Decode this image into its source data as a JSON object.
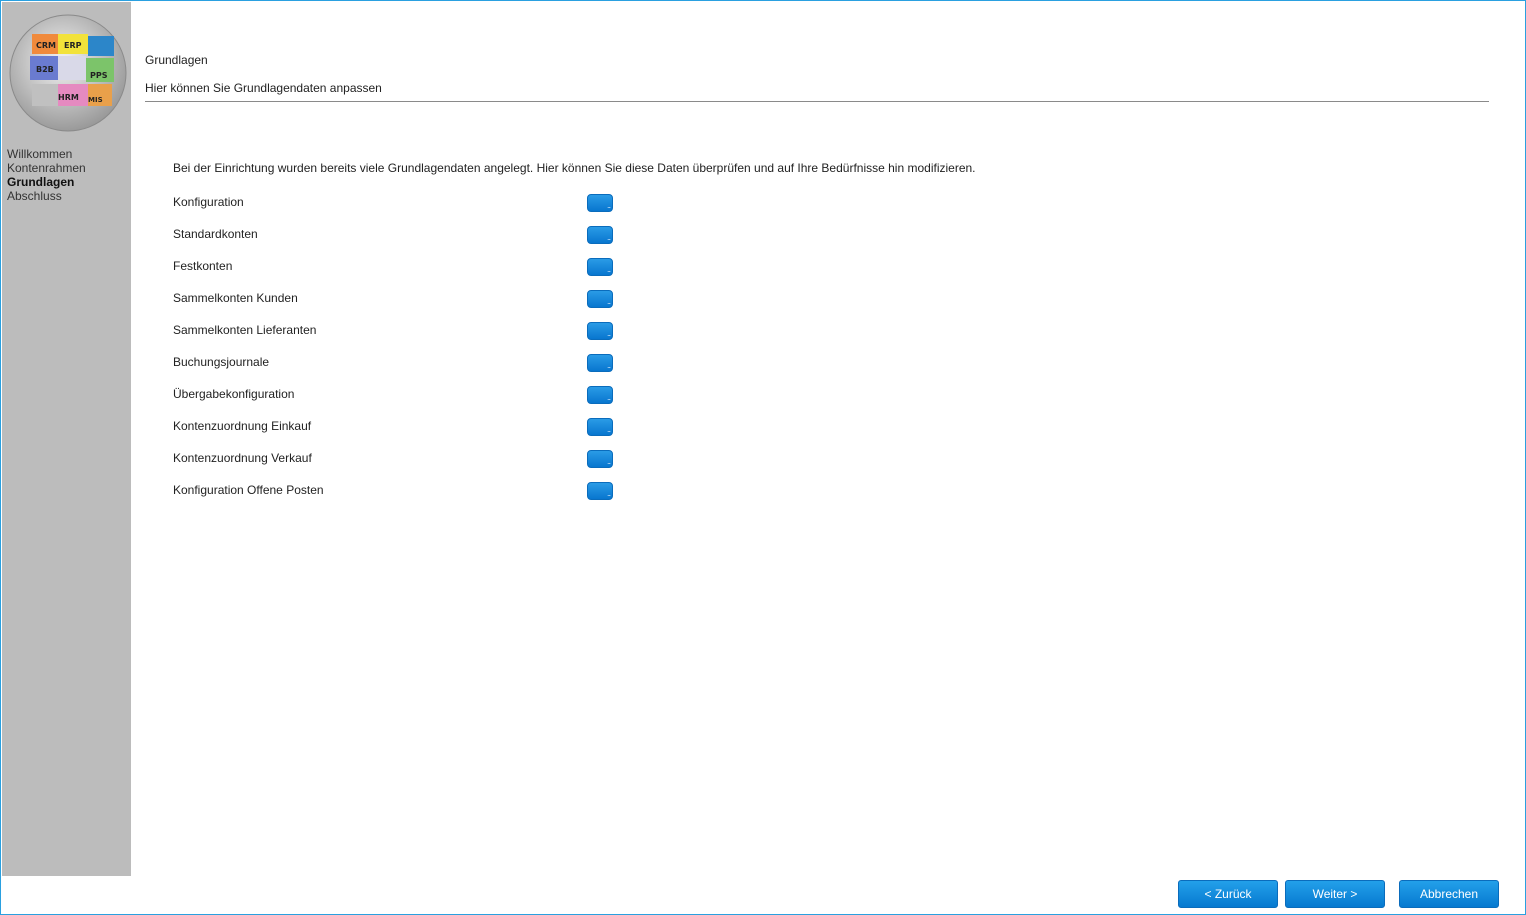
{
  "logo": {
    "pieces": [
      "CRM",
      "ERP",
      "B2B",
      "PPS",
      "HRM",
      "MIS"
    ]
  },
  "sidebar": {
    "items": [
      {
        "label": "Willkommen",
        "active": false
      },
      {
        "label": "Kontenrahmen",
        "active": false
      },
      {
        "label": "Grundlagen",
        "active": true
      },
      {
        "label": "Abschluss",
        "active": false
      }
    ]
  },
  "header": {
    "title": "Grundlagen",
    "subtitle": "Hier können Sie Grundlagendaten anpassen"
  },
  "main": {
    "intro": "Bei der Einrichtung wurden bereits viele Grundlagendaten angelegt. Hier können Sie diese Daten überprüfen und auf Ihre Bedürfnisse hin modifizieren.",
    "rows": [
      {
        "label": "Konfiguration",
        "button_icon": "ellipsis-icon"
      },
      {
        "label": "Standardkonten",
        "button_icon": "ellipsis-icon"
      },
      {
        "label": "Festkonten",
        "button_icon": "ellipsis-icon"
      },
      {
        "label": "Sammelkonten Kunden",
        "button_icon": "ellipsis-icon"
      },
      {
        "label": "Sammelkonten Lieferanten",
        "button_icon": "ellipsis-icon"
      },
      {
        "label": "Buchungsjournale",
        "button_icon": "ellipsis-icon"
      },
      {
        "label": "Übergabekonfiguration",
        "button_icon": "ellipsis-icon"
      },
      {
        "label": "Kontenzuordnung Einkauf",
        "button_icon": "ellipsis-icon"
      },
      {
        "label": "Kontenzuordnung Verkauf",
        "button_icon": "ellipsis-icon"
      },
      {
        "label": "Konfiguration Offene Posten",
        "button_icon": "ellipsis-icon"
      }
    ]
  },
  "footer": {
    "back_label": "< Zurück",
    "next_label": "Weiter >",
    "cancel_label": "Abbrechen"
  },
  "colors": {
    "accent": "#0a84d6",
    "sidebar_bg": "#bcbcbc",
    "frame_border": "#2aa0e0"
  }
}
